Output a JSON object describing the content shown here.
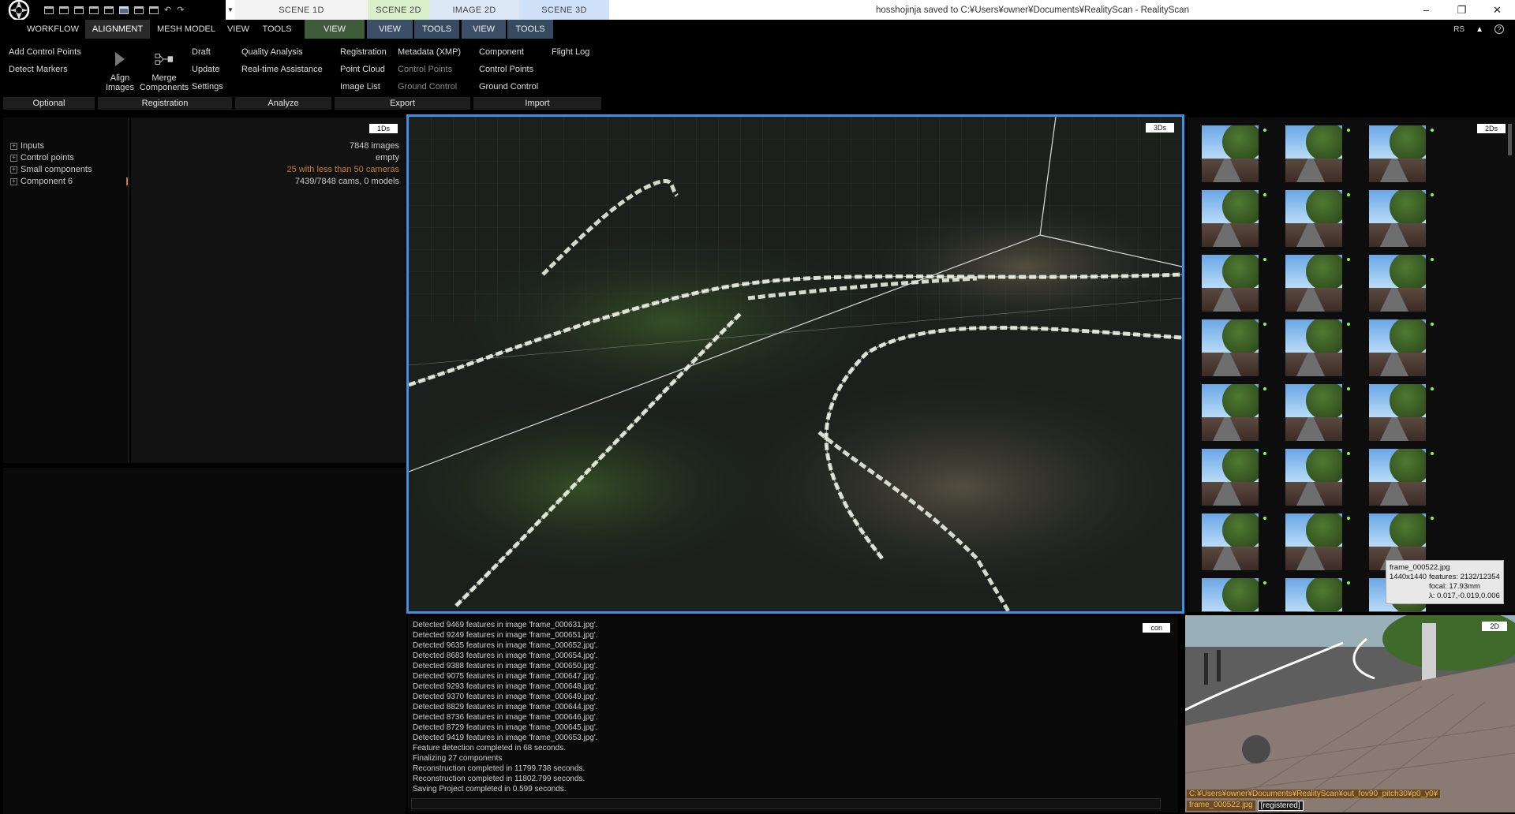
{
  "titlebar": {
    "title": "hosshojinja saved to C:¥Users¥owner¥Documents¥RealityScan - RealityScan",
    "scene_tabs": {
      "scene1d": "SCENE 1D",
      "scene2d": "SCENE 2D",
      "image2d": "IMAGE 2D",
      "scene3d": "SCENE 3D"
    },
    "buttons": {
      "minimize": "–",
      "restore": "❐",
      "close": "✕"
    }
  },
  "menu": {
    "workflow": "WORKFLOW",
    "alignment": "ALIGNMENT",
    "mesh_model": "MESH MODEL",
    "view": "VIEW",
    "tools": "TOOLS",
    "ctx_view_1": "VIEW",
    "ctx_view_2": "VIEW",
    "ctx_tools_2": "TOOLS",
    "ctx_view_3": "VIEW",
    "ctx_tools_3": "TOOLS",
    "rs": "RS",
    "warn": "▲",
    "help": "?"
  },
  "ribbon": {
    "optional": {
      "label": "Optional",
      "add_cp": "Add Control Points",
      "detect_markers": "Detect Markers"
    },
    "registration": {
      "label": "Registration",
      "align_line1": "Align",
      "align_line2": "Images",
      "merge_line1": "Merge",
      "merge_line2": "Components",
      "draft": "Draft",
      "update": "Update",
      "settings": "Settings"
    },
    "analyze": {
      "label": "Analyze",
      "quality": "Quality Analysis",
      "realtime": "Real-time Assistance"
    },
    "export": {
      "label": "Export",
      "registration": "Registration",
      "point_cloud": "Point Cloud",
      "image_list": "Image List",
      "metadata": "Metadata (XMP)",
      "control_points": "Control Points",
      "ground_control": "Ground Control"
    },
    "import": {
      "label": "Import",
      "component": "Component",
      "control_points": "Control Points",
      "ground_control": "Ground Control",
      "flight_log": "Flight Log"
    }
  },
  "tree": {
    "badge": "1Ds",
    "items": [
      "Inputs",
      "Control points",
      "Small components",
      "Component 6"
    ],
    "info": [
      "7848 images",
      "empty",
      "25 with less than 50 cameras",
      "7439/7848 cams, 0 models"
    ]
  },
  "view3d": {
    "badge": "3Ds"
  },
  "images": {
    "badge": "2Ds",
    "tooltip": {
      "name": "frame_000522.jpg",
      "size": "1440x1440",
      "features": "features: 2132/12354",
      "focal": "focal: 17.93mm",
      "lambda": "λ: 0.017,-0.019,0.006"
    }
  },
  "console": {
    "badge": "con",
    "lines": [
      "Detected 9469 features in image 'frame_000631.jpg'.",
      "Detected 9249 features in image 'frame_000651.jpg'.",
      "Detected 9635 features in image 'frame_000652.jpg'.",
      "Detected 8683 features in image 'frame_000654.jpg'.",
      "Detected 9388 features in image 'frame_000650.jpg'.",
      "Detected 9075 features in image 'frame_000647.jpg'.",
      "Detected 9293 features in image 'frame_000648.jpg'.",
      "Detected 9370 features in image 'frame_000649.jpg'.",
      "Detected 8829 features in image 'frame_000644.jpg'.",
      "Detected 8736 features in image 'frame_000646.jpg'.",
      "Detected 8729 features in image 'frame_000645.jpg'.",
      "Detected 9419 features in image 'frame_000653.jpg'.",
      "Feature detection completed in 68 seconds.",
      "Finalizing 27 components",
      "Reconstruction completed in 11799.738 seconds.",
      "Reconstruction completed in 11802.799 seconds.",
      "Saving Project completed in 0.599 seconds."
    ]
  },
  "view2d": {
    "badge": "2D",
    "path": "C:¥Users¥owner¥Documents¥RealityScan¥out_fov90_pitch30¥p0_y0¥",
    "file": "frame_000522.jpg",
    "status": "[registered]"
  },
  "colors": {
    "accent": "#3d8fe8",
    "warning": "#c47e33",
    "registered_dot": "#7cff3a"
  }
}
